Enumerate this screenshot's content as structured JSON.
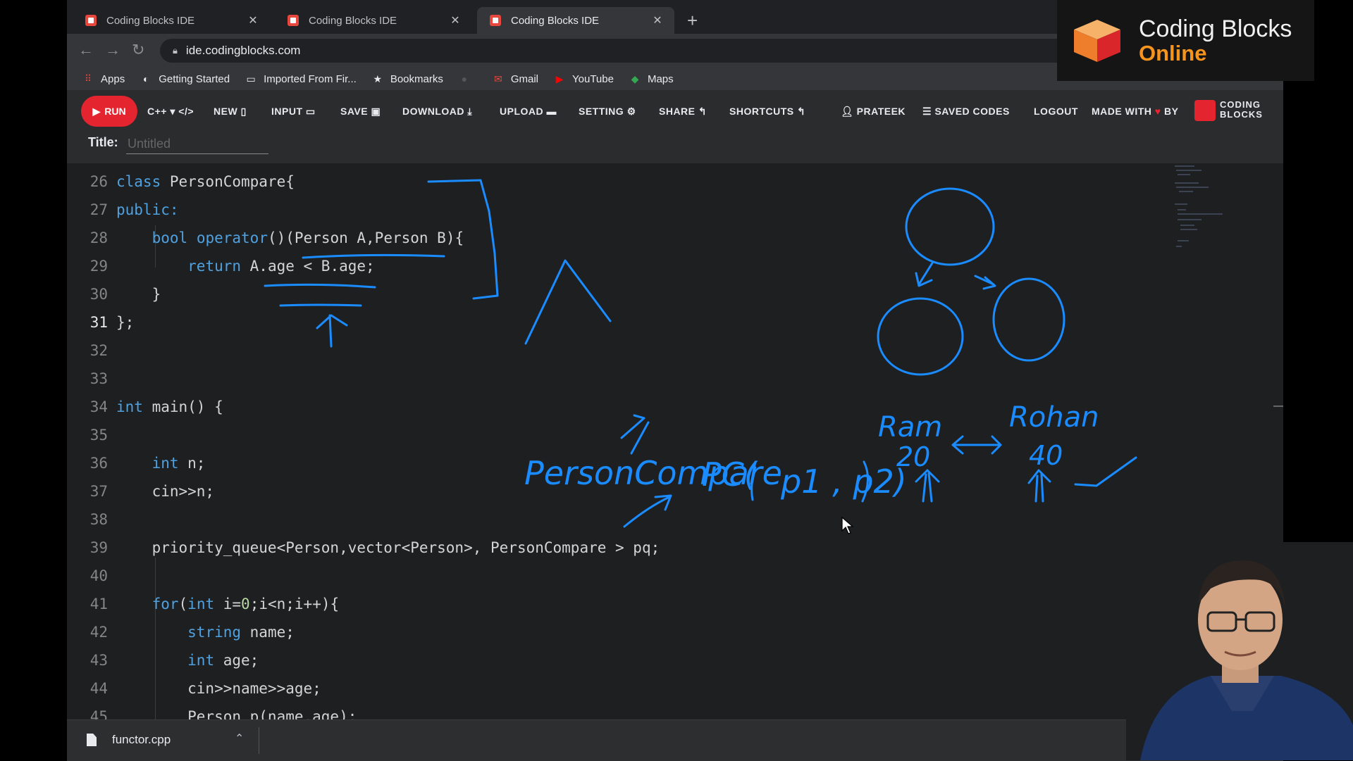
{
  "browser": {
    "tabs": [
      {
        "title": "Coding Blocks IDE",
        "active": false
      },
      {
        "title": "Coding Blocks IDE",
        "active": false
      },
      {
        "title": "Coding Blocks IDE",
        "active": true
      }
    ],
    "url": "ide.codingblocks.com",
    "bookmarks": [
      {
        "label": "Apps",
        "icon": "apps-grid-icon"
      },
      {
        "label": "Getting Started",
        "icon": "globe-icon"
      },
      {
        "label": "Imported From Fir...",
        "icon": "folder-icon"
      },
      {
        "label": "Bookmarks",
        "icon": "star-icon"
      },
      {
        "label": "",
        "icon": "github-icon"
      },
      {
        "label": "Gmail",
        "icon": "gmail-icon"
      },
      {
        "label": "YouTube",
        "icon": "youtube-icon"
      },
      {
        "label": "Maps",
        "icon": "maps-icon"
      }
    ]
  },
  "toolbar": {
    "run": "RUN",
    "language": "C++",
    "new": "NEW",
    "input": "INPUT",
    "save": "SAVE",
    "download": "DOWNLOAD",
    "upload": "UPLOAD",
    "setting": "SETTING",
    "share": "SHARE",
    "shortcuts": "SHORTCUTS",
    "user": "PRATEEK",
    "saved_codes": "SAVED CODES",
    "logout": "LOGOUT",
    "made_with": "MADE WITH",
    "by": "BY",
    "brand_small_1": "CODING",
    "brand_small_2": "BLOCKS"
  },
  "title_field": {
    "label": "Title:",
    "placeholder": "Untitled"
  },
  "editor": {
    "current_line": "31",
    "lines": [
      {
        "n": "26",
        "text": "class PersonCompare{"
      },
      {
        "n": "27",
        "text": "public:"
      },
      {
        "n": "28",
        "text": "    bool operator()(Person A,Person B){"
      },
      {
        "n": "29",
        "text": "        return A.age < B.age;"
      },
      {
        "n": "30",
        "text": "    }"
      },
      {
        "n": "31",
        "text": "};"
      },
      {
        "n": "32",
        "text": ""
      },
      {
        "n": "33",
        "text": ""
      },
      {
        "n": "34",
        "text": "int main() {"
      },
      {
        "n": "35",
        "text": ""
      },
      {
        "n": "36",
        "text": "    int n;"
      },
      {
        "n": "37",
        "text": "    cin>>n;"
      },
      {
        "n": "38",
        "text": ""
      },
      {
        "n": "39",
        "text": "    priority_queue<Person,vector<Person>, PersonCompare > pq;"
      },
      {
        "n": "40",
        "text": ""
      },
      {
        "n": "41",
        "text": "    for(int i=0;i<n;i++){"
      },
      {
        "n": "42",
        "text": "        string name;"
      },
      {
        "n": "43",
        "text": "        int age;"
      },
      {
        "n": "44",
        "text": "        cin>>name>>age;"
      },
      {
        "n": "45",
        "text": "        Person p(name,age);"
      }
    ]
  },
  "annotations": {
    "ink_color": "#1a8cff",
    "text_1": "PersonCompare",
    "text_2": "PC(",
    "text_3": "p1 , p2)",
    "text_4": "Ram",
    "text_5": "20",
    "text_6": "Rohan",
    "text_7": "40"
  },
  "download_bar": {
    "file": "functor.cpp"
  },
  "brand": {
    "line1": "Coding Blocks",
    "line2": "Online"
  },
  "colors": {
    "run": "#e4252f",
    "keyword": "#4fa1e0",
    "brand_orange": "#f7941d"
  }
}
